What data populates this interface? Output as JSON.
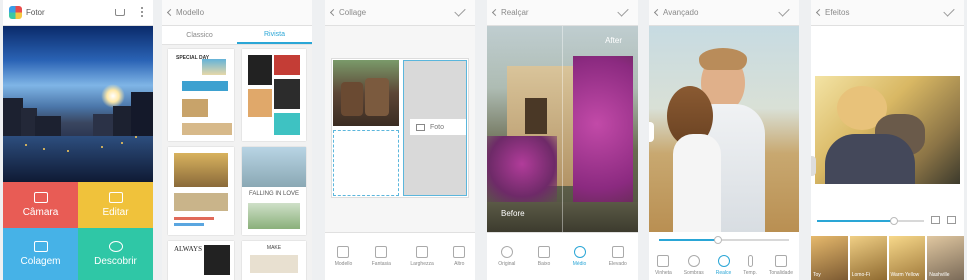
{
  "colors": {
    "accent": "#2aa6d6",
    "camera": "#e85c55",
    "edit": "#f0c23b",
    "collage": "#46b2e7",
    "discover": "#2fc7a6"
  },
  "panel1": {
    "app_title": "Fotor",
    "tiles": [
      {
        "label": "Câmara",
        "icon": "camera-icon"
      },
      {
        "label": "Editar",
        "icon": "edit-icon"
      },
      {
        "label": "Colagem",
        "icon": "collage-icon"
      },
      {
        "label": "Descobrir",
        "icon": "search-icon"
      }
    ]
  },
  "panel2": {
    "back_label": "Modello",
    "tabs": [
      "Classico",
      "Rivista"
    ],
    "active_tab": 1,
    "thumb_texts": {
      "special_day": "SPECIAL DAY",
      "falling": "FALLING IN LOVE",
      "always": "ALWAYS",
      "make": "MAKE"
    }
  },
  "panel3": {
    "back_label": "Collage",
    "slot_label": "Foto",
    "tools": [
      "Modello",
      "Fantasia",
      "Larghezza",
      "Altro"
    ]
  },
  "panel4": {
    "back_label": "Realçar",
    "after": "After",
    "before": "Before",
    "tools": [
      "Original",
      "Baixo",
      "Médio",
      "Elevado"
    ],
    "selected_tool": 2
  },
  "panel5": {
    "back_label": "Avançado",
    "tools": [
      "Vinheta",
      "Sombras",
      "Realce",
      "Temp.",
      "Tonalidade"
    ],
    "selected_tool": 2,
    "slider_level": 0.45
  },
  "panel6": {
    "back_label": "Efeitos",
    "slider_level": 0.72,
    "filters": [
      "Toy",
      "Lomo-Fi",
      "Warm Yellow",
      "Nashville"
    ]
  }
}
